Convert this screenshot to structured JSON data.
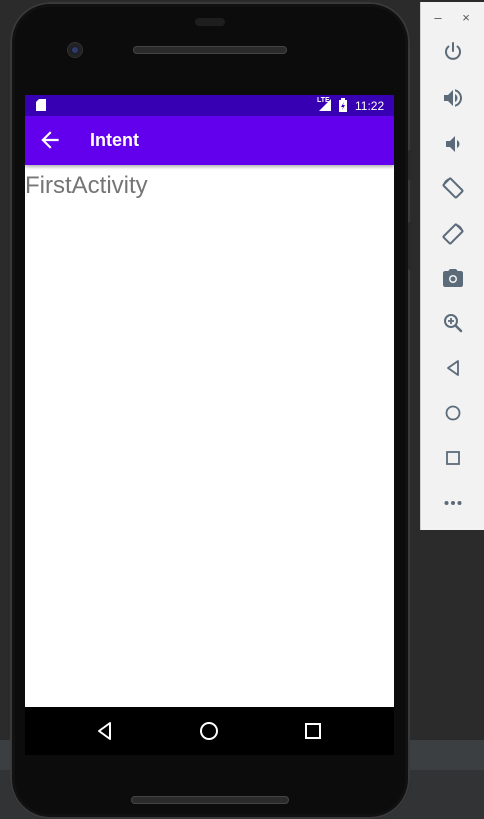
{
  "status_bar": {
    "time": "11:22",
    "network_label": "LTE",
    "icons": [
      "sd-card-icon",
      "lte-signal-icon",
      "battery-charging-icon"
    ]
  },
  "app_bar": {
    "title": "Intent",
    "back_icon": "arrow-back-icon"
  },
  "content": {
    "label": "FirstActivity"
  },
  "nav_bar": {
    "buttons": [
      "back-triangle-icon",
      "home-circle-icon",
      "recents-square-icon"
    ]
  },
  "emulator_toolbar": {
    "minimize_label": "–",
    "close_label": "×",
    "buttons": [
      "power-icon",
      "volume-up-icon",
      "volume-down-icon",
      "rotate-left-icon",
      "rotate-right-icon",
      "camera-icon",
      "zoom-icon",
      "back-icon",
      "home-icon",
      "overview-icon",
      "more-icon"
    ]
  },
  "colors": {
    "status_bar": "#3700b3",
    "app_bar": "#6200ee",
    "content_text": "#757575",
    "toolbar_icon": "#5c6b7a"
  }
}
